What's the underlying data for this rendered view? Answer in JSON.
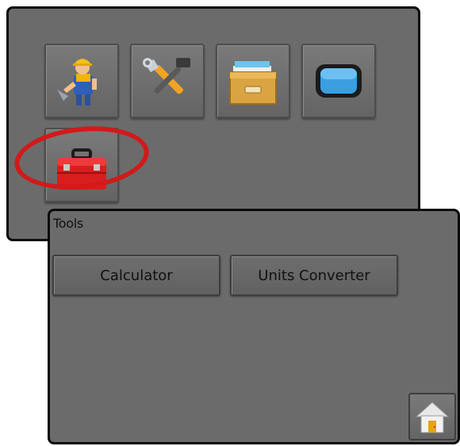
{
  "menu": {
    "tiles": [
      {
        "icon": "worker-icon"
      },
      {
        "icon": "tools-setup-icon"
      },
      {
        "icon": "file-box-icon"
      },
      {
        "icon": "display-screen-icon"
      },
      {
        "icon": "toolbox-icon"
      }
    ],
    "highlight_color": "#d11a1a"
  },
  "tools_panel": {
    "title": "Tools",
    "buttons": {
      "calculator": "Calculator",
      "units_converter": "Units Converter"
    },
    "home_icon": "home-icon"
  },
  "colors": {
    "panel_bg": "#6b6b6b",
    "border": "#0a0a0a"
  }
}
